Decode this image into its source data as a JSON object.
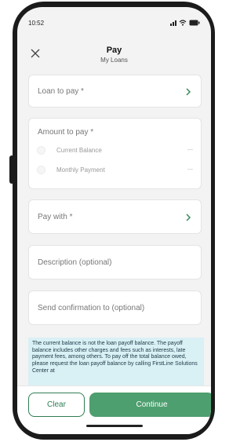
{
  "status_bar": {
    "time": "10:52"
  },
  "header": {
    "title": "Pay",
    "subtitle": "My Loans"
  },
  "form": {
    "loan_to_pay_label": "Loan to pay *",
    "amount_to_pay_label": "Amount to pay *",
    "amount_options": [
      {
        "label": "Current Balance",
        "value": "---"
      },
      {
        "label": "Monthly Payment",
        "value": "---"
      }
    ],
    "pay_with_label": "Pay with *",
    "description_placeholder": "Description (optional)",
    "confirmation_placeholder": "Send confirmation to (optional)"
  },
  "notice": {
    "text": "The current balance is not the loan payoff balance. The payoff balance includes other charges and fees such as interests, late payment fees, among others. To pay off the total balance owed, please request the loan payoff balance by calling FirstLine Solutions Center at"
  },
  "footer": {
    "clear_label": "Clear",
    "continue_label": "Continue"
  },
  "colors": {
    "accent": "#4e9f6f",
    "accent_dark": "#2e7d53",
    "notice_bg": "#d9f0f5"
  }
}
